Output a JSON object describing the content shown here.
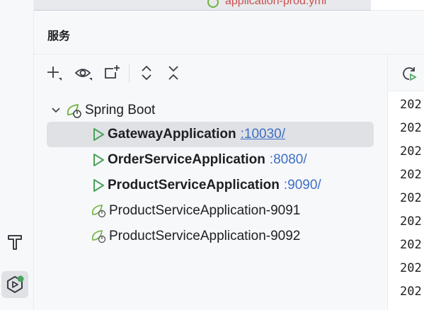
{
  "top_tab": {
    "filename": "application-prod.yml"
  },
  "panel": {
    "title": "服务"
  },
  "toolbar": {
    "items": [
      {
        "icon": "add-icon"
      },
      {
        "icon": "eye-icon"
      },
      {
        "icon": "new-window-icon"
      },
      {
        "icon": "expand-all-icon"
      },
      {
        "icon": "collapse-all-icon"
      }
    ]
  },
  "tree": {
    "group": {
      "label": "Spring Boot",
      "expanded": true,
      "icon": "spring-boot-icon"
    },
    "items": [
      {
        "name": "GatewayApplication",
        "port": ":10030/",
        "running": true,
        "selected": true
      },
      {
        "name": "OrderServiceApplication",
        "port": ":8080/",
        "running": true,
        "selected": false
      },
      {
        "name": "ProductServiceApplication",
        "port": ":9090/",
        "running": true,
        "selected": false
      },
      {
        "name": "ProductServiceApplication-9091",
        "port": "",
        "running": false,
        "selected": false
      },
      {
        "name": "ProductServiceApplication-9092",
        "port": "",
        "running": false,
        "selected": false
      }
    ]
  },
  "console": {
    "lines": [
      "202",
      "202",
      "202",
      "202",
      "202",
      "202",
      "202",
      "202",
      "202"
    ]
  },
  "colors": {
    "run_green": "#4aa35b",
    "port_blue": "#3d6fc4",
    "selection": "#dfe1e5",
    "spring_green": "#6db33f"
  }
}
